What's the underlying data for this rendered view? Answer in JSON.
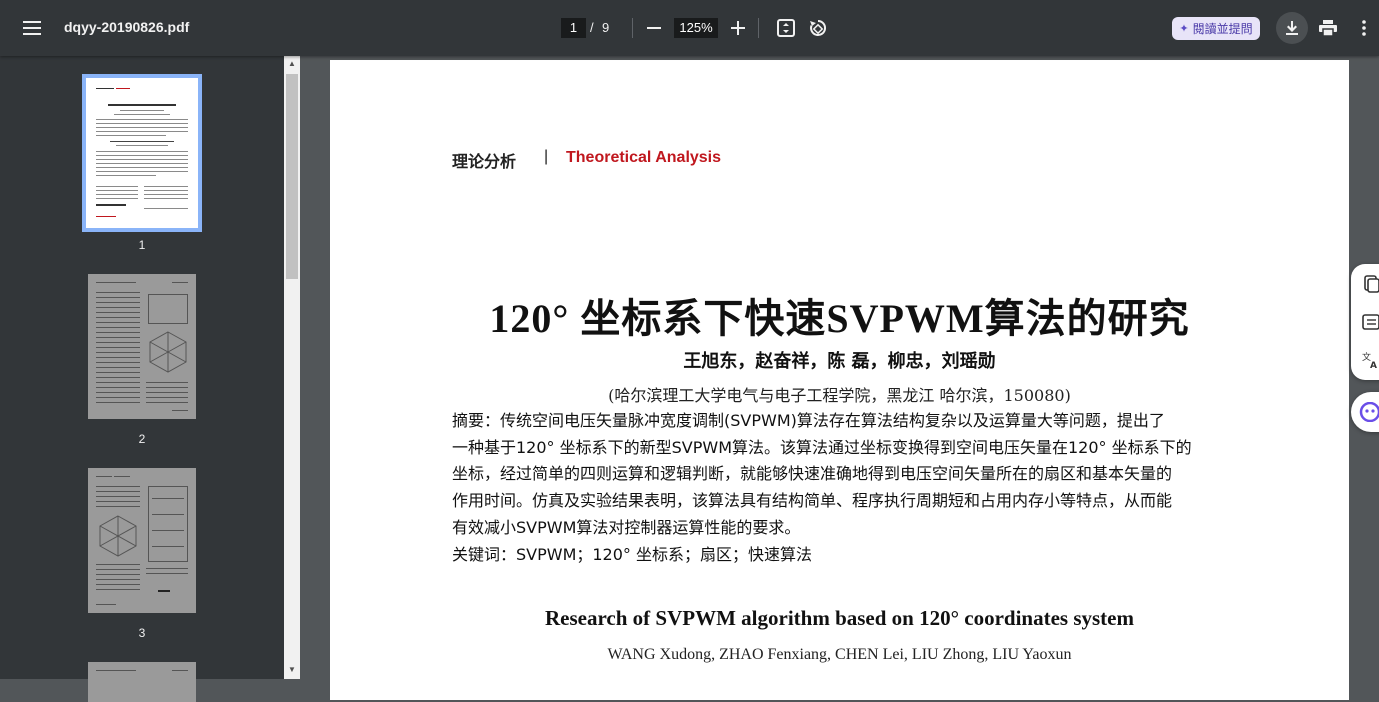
{
  "toolbar": {
    "filename": "dqyy-20190826.pdf",
    "current_page": "1",
    "page_separator": "/",
    "total_pages": "9",
    "zoom": "125%",
    "ai_button_label": "閱讀並提問"
  },
  "sidebar": {
    "thumbnails": [
      {
        "number": "1",
        "selected": true
      },
      {
        "number": "2",
        "selected": false
      },
      {
        "number": "3",
        "selected": false
      }
    ]
  },
  "document": {
    "section_cn": "理论分析",
    "section_sep": "|",
    "section_en": "Theoretical Analysis",
    "title": "120° 坐标系下快速SVPWM算法的研究",
    "authors": "王旭东，赵奋祥，陈 磊，柳忠，刘瑶勋",
    "affiliation": "(哈尔滨理工大学电气与电子工程学院，黑龙江  哈尔滨，150080)",
    "abstract_lines": [
      "摘要：传统空间电压矢量脉冲宽度调制(SVPWM)算法存在算法结构复杂以及运算量大等问题，提出了",
      "一种基于120° 坐标系下的新型SVPWM算法。该算法通过坐标变换得到空间电压矢量在120° 坐标系下的",
      "坐标，经过简单的四则运算和逻辑判断，就能够快速准确地得到电压空间矢量所在的扇区和基本矢量的",
      "作用时间。仿真及实验结果表明，该算法具有结构简单、程序执行周期短和占用内存小等特点，从而能",
      "有效减小SVPWM算法对控制器运算性能的要求。"
    ],
    "keywords": "关键词：SVPWM；120° 坐标系；扇区；快速算法",
    "en_title": "Research of SVPWM algorithm based on 120° coordinates system",
    "en_authors": "WANG Xudong, ZHAO Fenxiang, CHEN Lei, LIU Zhong, LIU Yaoxun"
  },
  "colors": {
    "toolbar_bg": "#323639",
    "viewer_bg": "#525659",
    "accent_red": "#c0171e",
    "selected_thumb": "#8ab4f8"
  }
}
